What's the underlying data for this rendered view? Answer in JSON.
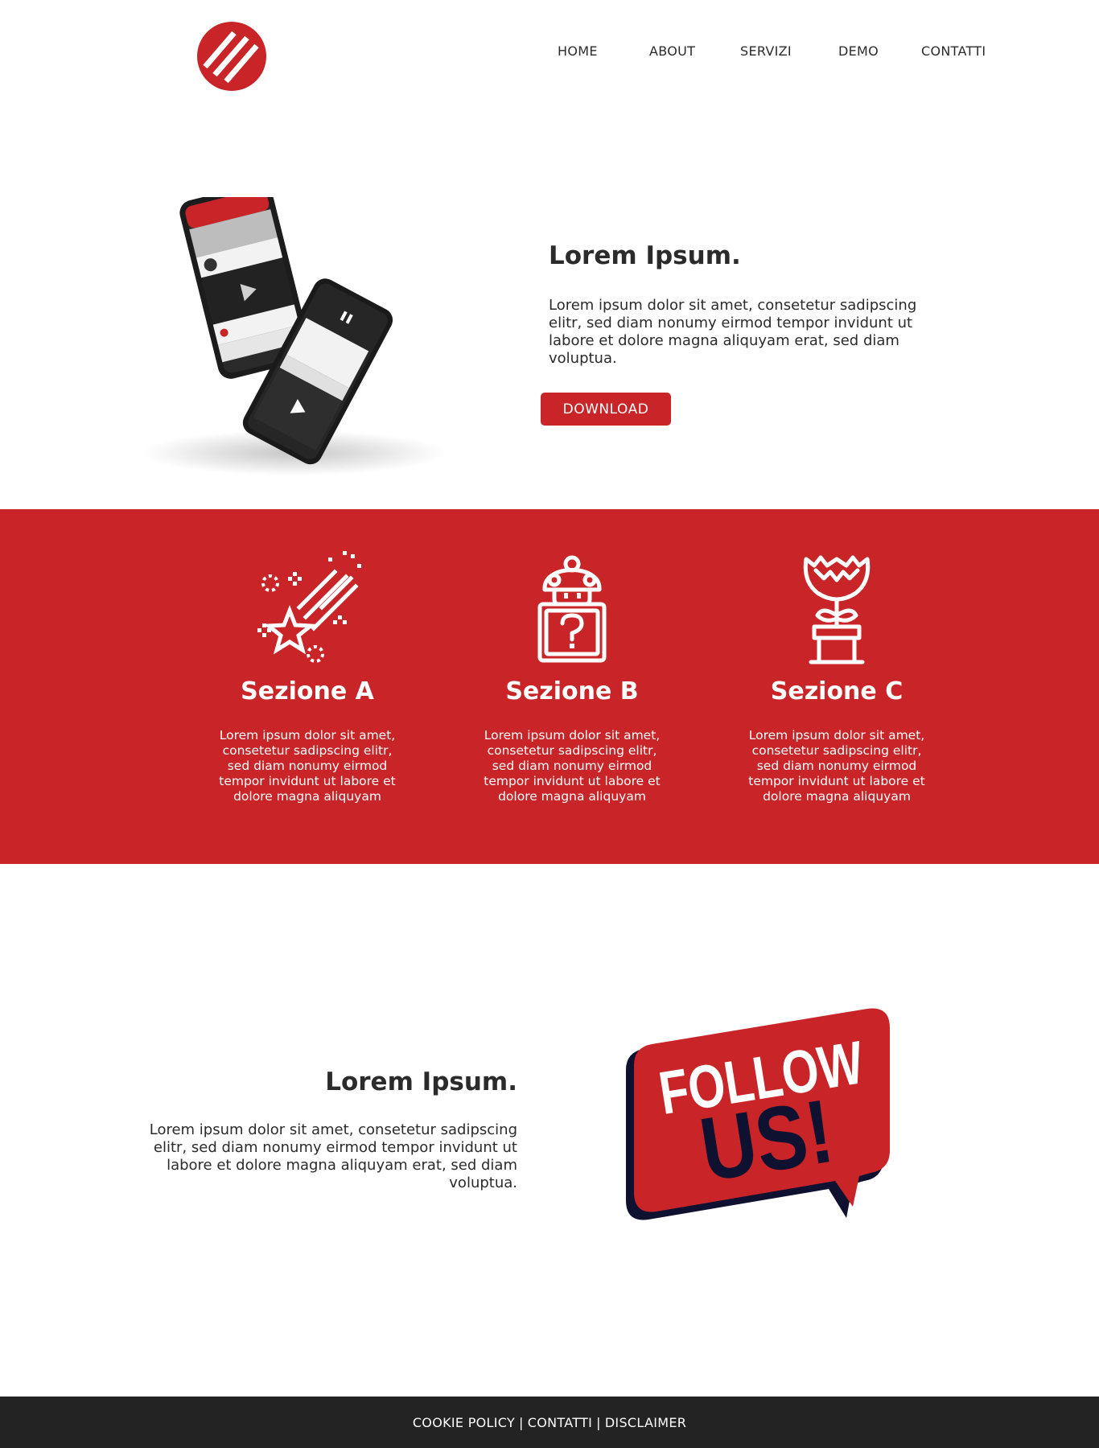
{
  "header": {
    "nav": [
      "HOME",
      "ABOUT",
      "SERVIZI",
      "DEMO",
      "CONTATTI"
    ]
  },
  "hero": {
    "title": "Lorem Ipsum.",
    "text": "Lorem ipsum dolor sit amet, consetetur sadipscing elitr, sed diam nonumy eirmod tempor invidunt ut labore et dolore magna aliquyam erat, sed diam voluptua.",
    "button": "DOWNLOAD"
  },
  "features": [
    {
      "title": "Sezione A",
      "text": "Lorem ipsum dolor sit amet, consetetur sadipscing elitr, sed diam nonumy eirmod tempor invidunt ut labore et dolore magna aliquyam",
      "icon": "shooting-star-icon"
    },
    {
      "title": "Sezione B",
      "text": "Lorem ipsum dolor sit amet, consetetur sadipscing elitr, sed diam nonumy eirmod tempor invidunt ut labore et dolore magna aliquyam",
      "icon": "mushroom-question-block-icon"
    },
    {
      "title": "Sezione C",
      "text": "Lorem ipsum dolor sit amet, consetetur sadipscing elitr, sed diam nonumy eirmod tempor invidunt ut labore et dolore magna aliquyam",
      "icon": "piranha-plant-icon"
    }
  ],
  "section2": {
    "title": "Lorem Ipsum.",
    "text": "Lorem ipsum dolor sit amet, consetetur sadipscing elitr, sed diam nonumy eirmod tempor invidunt ut labore et dolore magna aliquyam erat, sed diam voluptua.",
    "badge_line1": "FOLLOW",
    "badge_line2": "US!"
  },
  "footer": {
    "links": [
      "COOKIE POLICY",
      "CONTATTI",
      "DISCLAIMER"
    ],
    "separator": "|"
  },
  "colors": {
    "accent": "#c92427",
    "dark": "#232323",
    "navy": "#0f1130",
    "text": "#2b2b2b"
  }
}
